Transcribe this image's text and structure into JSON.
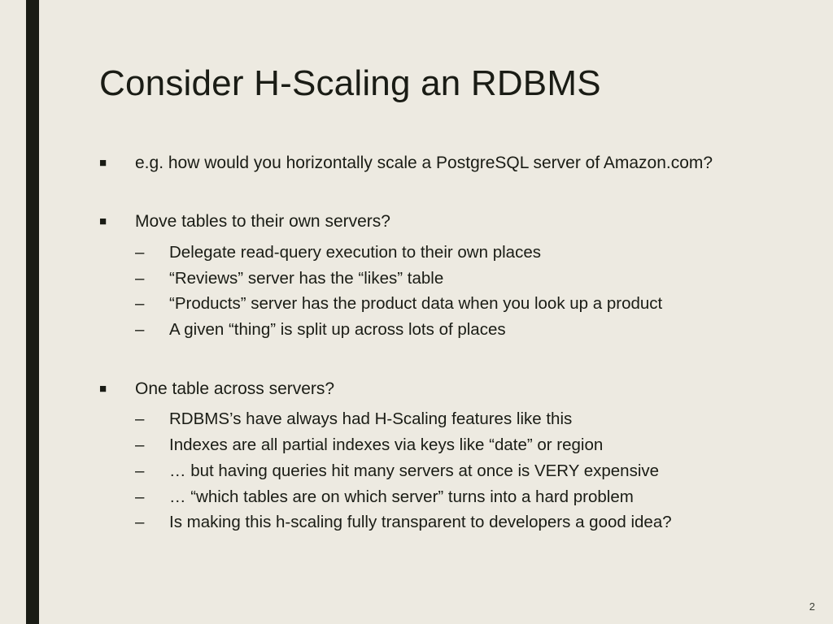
{
  "slide": {
    "title": "Consider H-Scaling an RDBMS",
    "page_number": "2",
    "items": [
      {
        "text": "e.g. how would you horizontally scale a PostgreSQL server of Amazon.com?",
        "sub": []
      },
      {
        "text": "Move tables to their own servers?",
        "sub": [
          "Delegate read-query execution to their own places",
          "“Reviews” server has the “likes” table",
          "“Products” server has the product data when you look up a product",
          "A given “thing” is split up across lots of places"
        ]
      },
      {
        "text": "One table across servers?",
        "sub": [
          "RDBMS’s have always had H-Scaling features like this",
          "Indexes are all partial indexes via keys like “date” or region",
          "… but having queries hit many servers at once is VERY expensive",
          "… “which tables are on which server” turns into a hard problem",
          "Is making this h-scaling fully transparent to developers a good idea?"
        ]
      }
    ]
  }
}
